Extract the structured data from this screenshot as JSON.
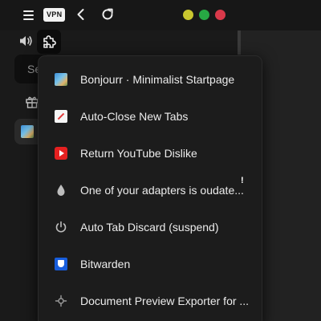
{
  "toolbar": {
    "vpn_label": "VPN"
  },
  "sidebar": {
    "search_stub": "Se"
  },
  "extensions_menu": {
    "items": [
      {
        "label": "Bonjourr · Minimalist Startpage",
        "icon": "bonjourr-icon"
      },
      {
        "label": "Auto-Close New Tabs",
        "icon": "auto-close-tabs-icon"
      },
      {
        "label": "Return YouTube Dislike",
        "icon": "youtube-dislike-icon"
      },
      {
        "label": "One of your adapters is oudate...",
        "icon": "water-drop-icon",
        "badge": "!"
      },
      {
        "label": "Auto Tab Discard (suspend)",
        "icon": "power-icon"
      },
      {
        "label": "Bitwarden",
        "icon": "bitwarden-icon"
      },
      {
        "label": "Document Preview Exporter for ...",
        "icon": "document-exporter-icon"
      }
    ]
  },
  "colors": {
    "window_yellow": "#c9c62f",
    "window_green": "#27a844",
    "window_red": "#d9394a",
    "menu_background": "#1c1c1c"
  }
}
